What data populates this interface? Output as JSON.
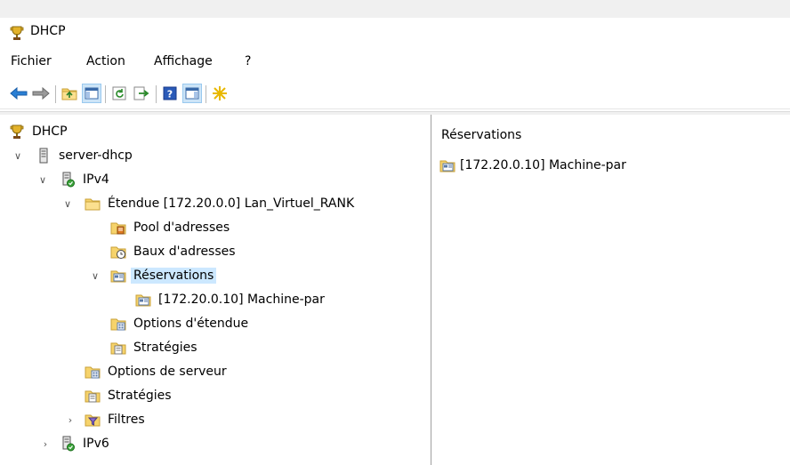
{
  "window": {
    "title": "DHCP",
    "icon": "dhcp-trophy-icon"
  },
  "menu": [
    "Fichier",
    "Action",
    "Affichage",
    "?"
  ],
  "toolbar": {
    "buttons": [
      "back-arrow-icon",
      "forward-arrow-icon",
      "up-folder-icon",
      "show-hide-console-tree-icon",
      "refresh-icon",
      "export-list-icon",
      "help-icon",
      "action-pane-icon",
      "new-star-icon"
    ],
    "active": [
      "show-hide-console-tree-icon",
      "action-pane-icon"
    ]
  },
  "tree": {
    "root": "DHCP",
    "server": "server-dhcp",
    "ipv4": "IPv4",
    "scope": "Étendue [172.20.0.0] Lan_Virtuel_RANK",
    "pool": "Pool d'adresses",
    "leases": "Baux d'adresses",
    "reservations": "Réservations",
    "reservation_item": "[172.20.0.10] Machine-par",
    "scope_options": "Options d'étendue",
    "scope_policies": "Stratégies",
    "server_options": "Options de serveur",
    "server_policies": "Stratégies",
    "filters": "Filtres",
    "ipv6": "IPv6"
  },
  "details": {
    "header": "Réservations",
    "items": [
      "[172.20.0.10] Machine-par"
    ]
  },
  "colors": {
    "selection": "#cce8ff",
    "toolbar_active": "#cce4f7",
    "folder": "#f2c94c"
  }
}
